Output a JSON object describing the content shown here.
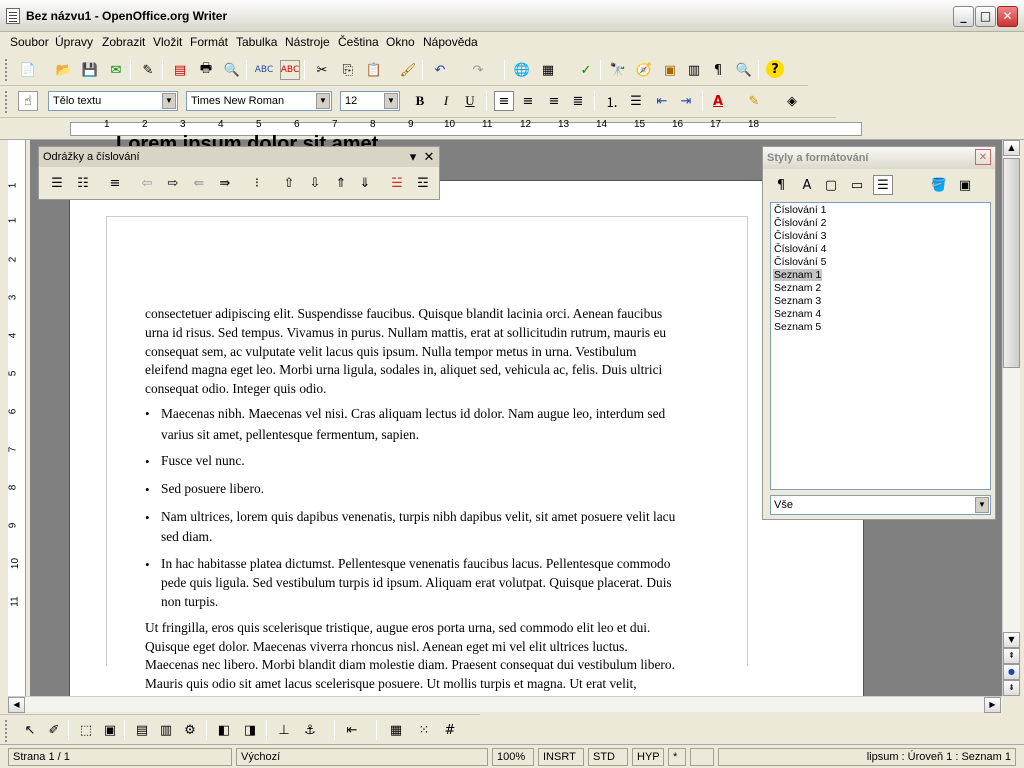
{
  "window": {
    "title": "Bez názvu1 - OpenOffice.org Writer"
  },
  "menubar": [
    "Soubor",
    "Úpravy",
    "Zobrazit",
    "Vložit",
    "Formát",
    "Tabulka",
    "Nástroje",
    "Čeština",
    "Okno",
    "Nápověda"
  ],
  "format": {
    "paragraph_style": "Tělo textu",
    "font_name": "Times New Roman",
    "font_size": "12"
  },
  "ruler": {
    "h_numbers": [
      "1",
      "2",
      "3",
      "4",
      "5",
      "6",
      "7",
      "8",
      "9",
      "10",
      "11",
      "12",
      "13",
      "14",
      "15",
      "16",
      "17",
      "18"
    ],
    "v_numbers": [
      "1",
      "1",
      "2",
      "3",
      "4",
      "5",
      "6",
      "7",
      "8",
      "9",
      "10",
      "11"
    ]
  },
  "bullets_toolbar": {
    "title": "Odrážky a číslování"
  },
  "styles_panel": {
    "title": "Styly a formátování",
    "items": [
      "Číslování 1",
      "Číslování 2",
      "Číslování 3",
      "Číslování 4",
      "Číslování 5",
      "Seznam 1",
      "Seznam 2",
      "Seznam 3",
      "Seznam 4",
      "Seznam 5"
    ],
    "selected": "Seznam 1",
    "filter": "Vše"
  },
  "document": {
    "heading": "Lorem ipsum dolor sit amet,",
    "para1": [
      "consectetuer adipiscing elit. Suspendisse faucibus. Quisque blandit lacinia orci. Aenean faucibus",
      "urna id risus. Sed tempus. Vivamus in purus. Nullam mattis, erat at sollicitudin rutrum, mauris eu",
      "consequat sem, ac vulputate velit lacus quis ipsum. Nulla tempor metus in urna. Vestibulum",
      "eleifend magna eget leo. Morbi urna ligula, sodales in, aliquet sed, vehicula ac, felis. Duis ultrici",
      "consequat odio. Integer quis odio."
    ],
    "bullets": [
      [
        "Maecenas nibh. Maecenas vel nisi. Cras aliquam lectus id dolor. Nam augue leo, interdum sed",
        "varius sit amet, pellentesque fermentum, sapien."
      ],
      [
        "Fusce vel nunc."
      ],
      [
        "Sed posuere libero."
      ],
      [
        "Nam ultrices, lorem quis dapibus venenatis, turpis nibh dapibus velit, sit amet posuere velit lacu",
        "sed diam."
      ],
      [
        "In hac habitasse platea dictumst. Pellentesque venenatis faucibus lacus. Pellentesque commodo",
        "pede quis ligula. Sed vestibulum turpis id ipsum. Aliquam erat volutpat. Quisque placerat. Duis",
        "non turpis."
      ]
    ],
    "para2": [
      "Ut fringilla, eros quis scelerisque tristique, augue eros porta urna, sed commodo elit leo et dui.",
      "Quisque eget dolor. Maecenas viverra rhoncus nisl. Aenean eget mi vel elit ultrices luctus.",
      "Maecenas nec libero. Morbi blandit diam molestie diam. Praesent consequat dui vestibulum libero.",
      "Mauris quis odio sit amet lacus scelerisque posuere. Ut mollis turpis et magna. Ut erat velit,"
    ]
  },
  "statusbar": {
    "page": "Strana 1 / 1",
    "style": "Výchozí",
    "zoom": "100%",
    "insert": "INSRT",
    "std": "STD",
    "hyp": "HYP",
    "modified": "*",
    "list_info": "lipsum : Úroveň 1 : Seznam 1"
  }
}
